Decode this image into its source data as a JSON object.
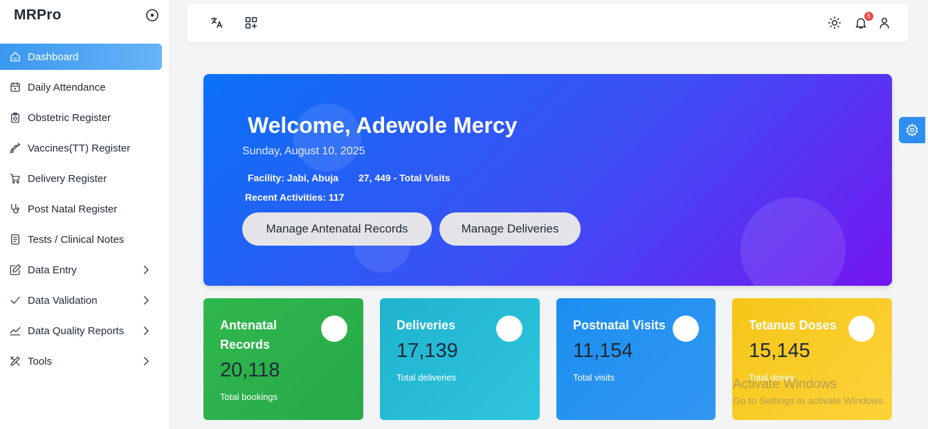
{
  "brand": {
    "name": "MRPro"
  },
  "sidebar": {
    "items": [
      {
        "label": "Dashboard",
        "icon": "home-icon",
        "active": true
      },
      {
        "label": "Daily Attendance",
        "icon": "calendar-icon"
      },
      {
        "label": "Obstetric Register",
        "icon": "clipboard-icon"
      },
      {
        "label": "Vaccines(TT) Register",
        "icon": "syringe-icon"
      },
      {
        "label": "Delivery Register",
        "icon": "stroller-icon"
      },
      {
        "label": "Post Natal Register",
        "icon": "stethoscope-icon"
      },
      {
        "label": "Tests / Clinical Notes",
        "icon": "notes-icon"
      },
      {
        "label": "Data Entry",
        "icon": "edit-icon",
        "expandable": true
      },
      {
        "label": "Data Validation",
        "icon": "check-icon",
        "expandable": true
      },
      {
        "label": "Data Quality Reports",
        "icon": "chart-line-icon",
        "expandable": true
      },
      {
        "label": "Tools",
        "icon": "tools-icon",
        "expandable": true
      }
    ]
  },
  "topbar": {
    "notification_count": "5"
  },
  "hero": {
    "title": "Welcome, Adewole Mercy",
    "date": "Sunday, August 10, 2025",
    "facility": "Facility: Jabi, Abuja",
    "visits": "27, 449 - Total Visits",
    "recent": "Recent Activities: 117",
    "btn_antenatal": "Manage Antenatal Records",
    "btn_deliveries": "Manage Deliveries"
  },
  "cards": [
    {
      "title": "Antenatal Records",
      "value": "20,118",
      "sub": "Total bookings",
      "color": "#2fb84e"
    },
    {
      "title": "Deliveries",
      "value": "17,139",
      "sub": "Total deliveries",
      "color": "#1fb3ce"
    },
    {
      "title": "Postnatal Visits",
      "value": "11,154",
      "sub": "Total visits",
      "color": "#1c8ef0"
    },
    {
      "title": "Tetanus Doses",
      "value": "15,145",
      "sub": "Total doses",
      "color": "#f5c518"
    }
  ],
  "watermark": {
    "title": "Activate Windows",
    "sub": "Go to Settings to activate Windows."
  }
}
